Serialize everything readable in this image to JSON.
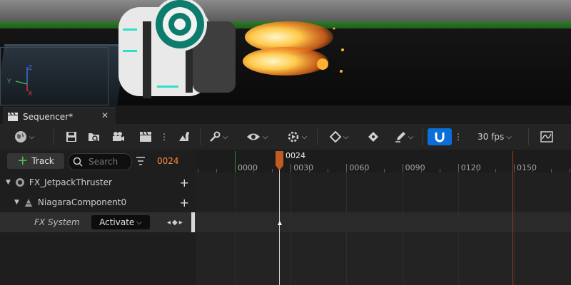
{
  "sequencer": {
    "tab_title": "Sequencer*",
    "close_symbol": "✕"
  },
  "toolbar": {
    "fps_label": "30 fps",
    "more_symbol": "⋮"
  },
  "panel": {
    "add_track_label": "Track",
    "search_placeholder": "Search",
    "current_frame": "0024"
  },
  "tracks": [
    {
      "label": "FX_JetpackThruster"
    },
    {
      "label": "NiagaraComponent0"
    },
    {
      "label": "FX System",
      "value": "Activate"
    }
  ],
  "timeline": {
    "playhead_label": "0024",
    "ticks": [
      "0000",
      "0030",
      "0060",
      "0090",
      "0120",
      "0150"
    ]
  },
  "viewport_axes": {
    "x": "X",
    "y": "Y",
    "z": "Z"
  },
  "colors": {
    "accent": "#0a6fd8",
    "playhead": "#c25a23",
    "frame_readout": "#ff8a3a",
    "start_marker": "#2f8f2f",
    "end_marker": "#9a3a1a"
  }
}
